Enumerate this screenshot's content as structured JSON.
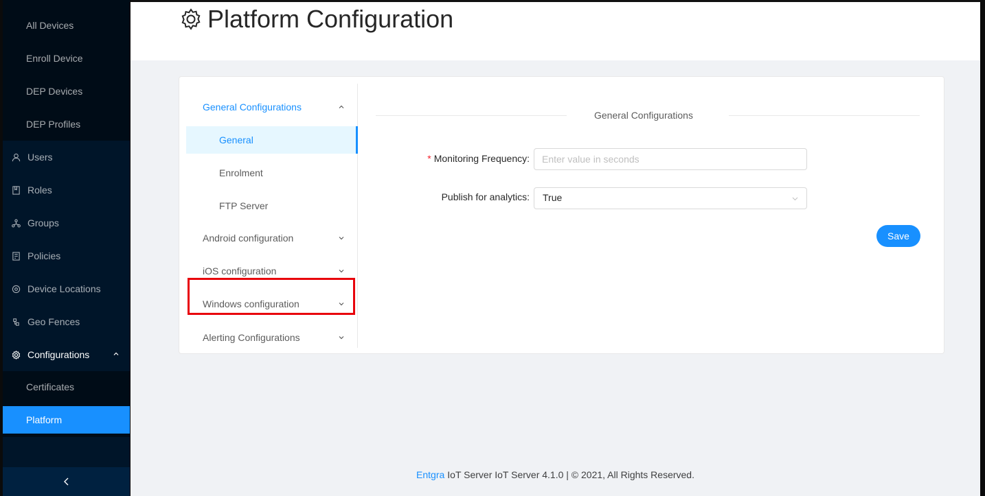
{
  "sidebar": {
    "device_items": [
      {
        "label": "All Devices"
      },
      {
        "label": "Enroll Device"
      },
      {
        "label": "DEP Devices"
      },
      {
        "label": "DEP Profiles"
      }
    ],
    "items": [
      {
        "label": "Users",
        "icon": "user-icon"
      },
      {
        "label": "Roles",
        "icon": "book-icon"
      },
      {
        "label": "Groups",
        "icon": "cluster-icon"
      },
      {
        "label": "Policies",
        "icon": "audit-icon"
      },
      {
        "label": "Device Locations",
        "icon": "location-icon"
      },
      {
        "label": "Geo Fences",
        "icon": "gateway-icon"
      },
      {
        "label": "Configurations",
        "icon": "settings-icon"
      }
    ],
    "config_items": [
      {
        "label": "Certificates"
      },
      {
        "label": "Platform"
      }
    ],
    "collapse_icon": "chevron-left-icon"
  },
  "header": {
    "title": "Platform Configuration",
    "icon": "settings-icon"
  },
  "config_menu": {
    "groups": [
      {
        "label": "General Configurations",
        "expanded": true
      },
      {
        "label": "Android configuration"
      },
      {
        "label": "iOS configuration"
      },
      {
        "label": "Windows configuration"
      },
      {
        "label": "Alerting Configurations"
      }
    ],
    "children": [
      {
        "label": "General"
      },
      {
        "label": "Enrolment"
      },
      {
        "label": "FTP Server"
      }
    ]
  },
  "form": {
    "section_title": "General Configurations",
    "monitoring_frequency": {
      "label": "Monitoring Frequency",
      "placeholder": "Enter value in seconds",
      "value": ""
    },
    "publish_analytics": {
      "label": "Publish for analytics",
      "value": "True"
    },
    "save_label": "Save"
  },
  "footer": {
    "brand": "Entgra",
    "text": "IoT Server IoT Server 4.1.0 | © 2021, All Rights Reserved."
  },
  "colors": {
    "sidebar_bg": "#001529",
    "accent": "#1890ff",
    "highlight_box": "#e8000b"
  }
}
